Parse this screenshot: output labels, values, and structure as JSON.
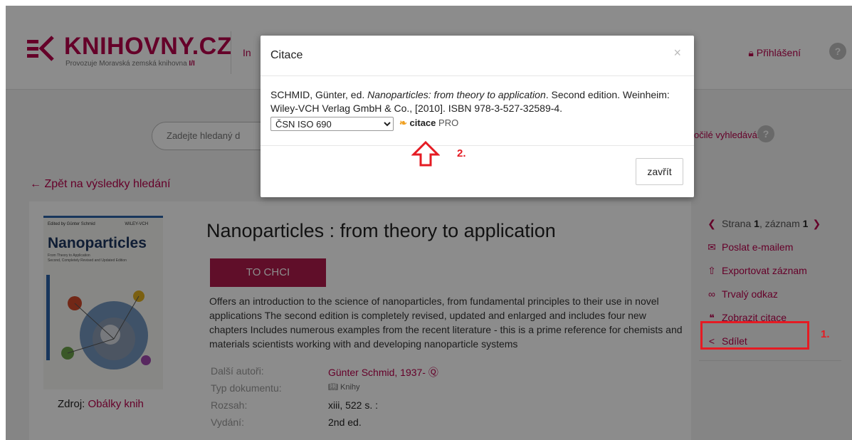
{
  "header": {
    "logo_text": "KNIHOVNY.CZ",
    "logo_sub": "Provozuje Moravská zemská knihovna",
    "nav_peek": "In",
    "login_label": "Přihlášení",
    "help_glyph": "?"
  },
  "search": {
    "placeholder": "Zadejte hledaný d",
    "advanced_label": "očilé vyhledávání"
  },
  "back_link": "← Zpět na výsledky hledání",
  "cover": {
    "small_left": "Edited by Günter Schmid",
    "small_right": "WILEY-VCH",
    "title": "Nanoparticles",
    "subtitle_1": "From Theory to Application",
    "subtitle_2": "Second, Completely Revised and Updated Edition"
  },
  "source": {
    "label": "Zdroj:",
    "link": "Obálky knih"
  },
  "book": {
    "title": "Nanoparticles : from theory to application",
    "want_button": "TO CHCI",
    "description": "Offers an introduction to the science of nanoparticles, from fundamental principles to their use in novel applications The second edition is completely revised, updated and enlarged and includes four new chapters Includes numerous examples from the recent literature - this is a prime reference for chemists and materials scientists working with and developing nanoparticle systems",
    "meta": [
      {
        "label": "Další autoři:",
        "value": "Günter Schmid, 1937-"
      },
      {
        "label": "Typ dokumentu:",
        "value": "Knihy"
      },
      {
        "label": "Rozsah:",
        "value": "xiii, 522 s. :"
      },
      {
        "label": "Vydání:",
        "value": "2nd ed."
      }
    ]
  },
  "sidebar": {
    "strana_prefix": "Strana ",
    "strana_num": "1",
    "zaznam_prefix": ", záznam ",
    "zaznam_num": "1",
    "items": [
      {
        "label": "Poslat e-mailem",
        "icon": "envelope-icon"
      },
      {
        "label": "Exportovat záznam",
        "icon": "export-icon"
      },
      {
        "label": "Trvalý odkaz",
        "icon": "link-icon"
      },
      {
        "label": "Zobrazit citace",
        "icon": "quote-bubble-icon"
      },
      {
        "label": "Sdílet",
        "icon": "share-icon"
      }
    ]
  },
  "annotations": {
    "num1": "1.",
    "num2": "2."
  },
  "modal": {
    "title": "Citace",
    "close_glyph": "×",
    "citation_author": "SCHMID, Günter, ed. ",
    "citation_title": "Nanoparticles: from theory to application",
    "citation_rest": ". Second edition. Weinheim: Wiley-VCH Verlag GmbH & Co., [2010]. ISBN 978-3-527-32589-4.",
    "style_selected": "ČSN ISO 690",
    "citace_word": "citace",
    "citace_pro": "PRO",
    "close_button": "zavřít"
  },
  "colors": {
    "brand": "#b8004c",
    "annotation": "#e51b23"
  }
}
